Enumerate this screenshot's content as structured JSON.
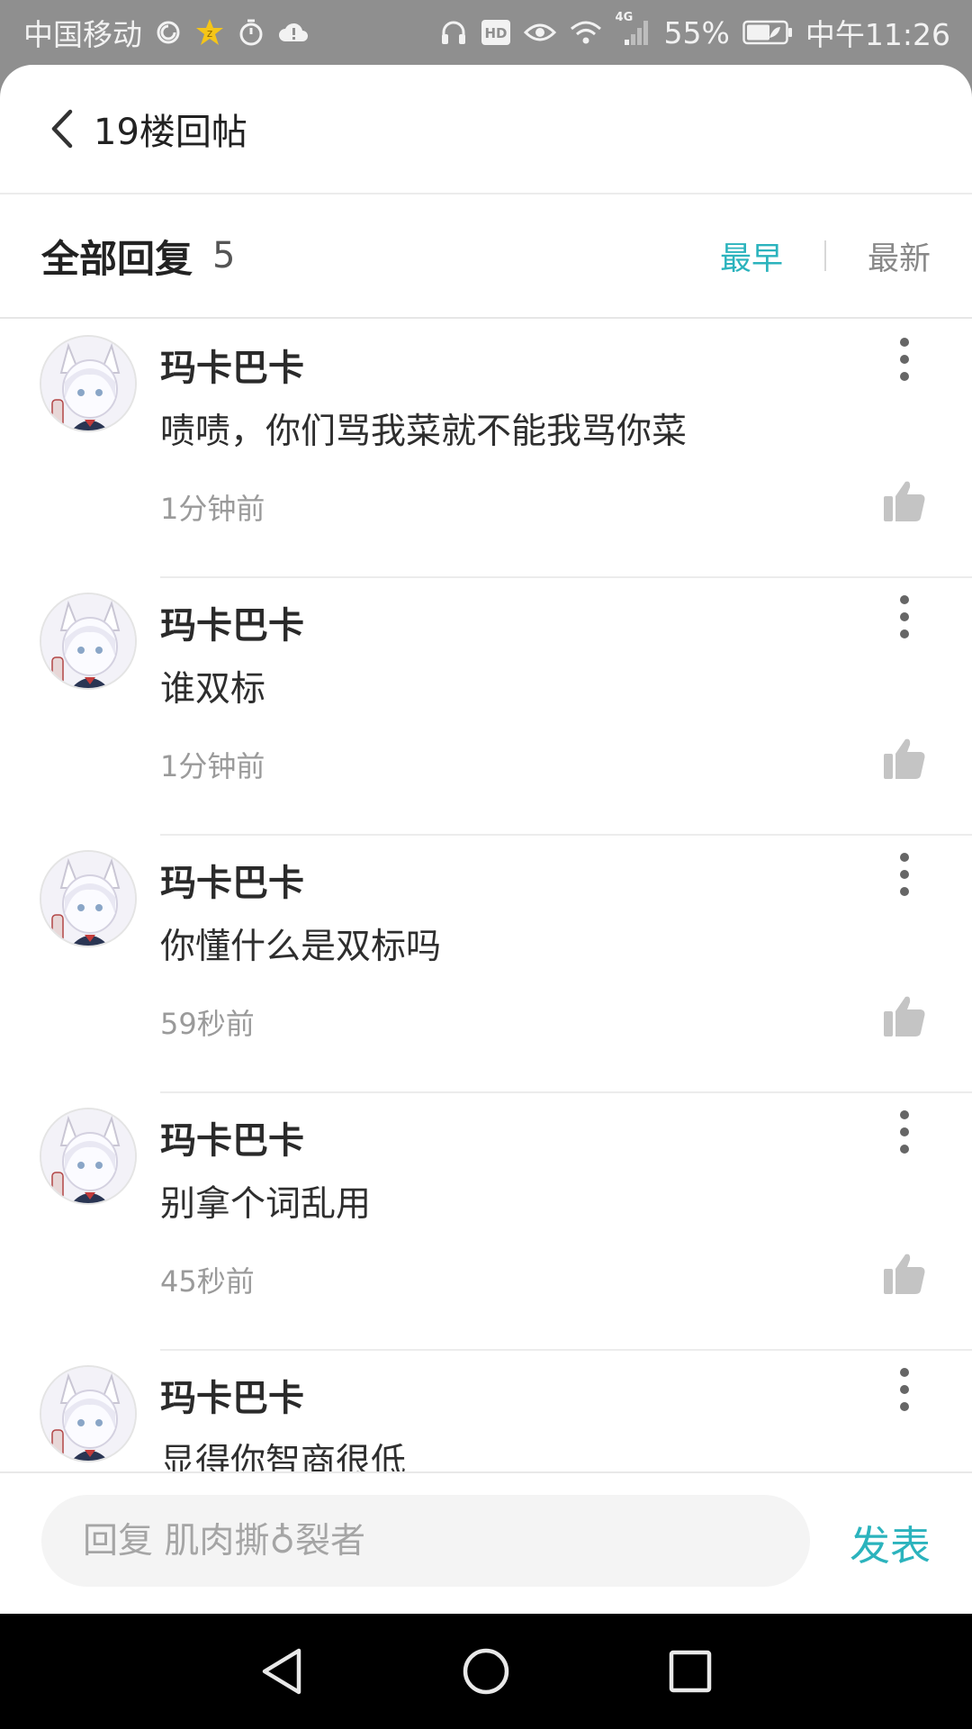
{
  "status_bar": {
    "carrier": "中国移动",
    "network": "4G",
    "battery": "55%",
    "time": "中午11:26",
    "icons": [
      "sync-icon",
      "star-badge-icon",
      "timer-icon",
      "cloud-alert-icon",
      "headphones-icon",
      "hd-icon",
      "eye-icon",
      "wifi-icon",
      "signal-icon",
      "battery-icon"
    ]
  },
  "header": {
    "back_icon": "chevron-left-icon",
    "title": "19楼回帖"
  },
  "replies": {
    "title": "全部回复",
    "count": "5",
    "sort_earliest": "最早",
    "sort_latest": "最新",
    "active_sort": "最早"
  },
  "comments": [
    {
      "author": "玛卡巴卡",
      "text": "啧啧，你们骂我菜就不能我骂你菜",
      "time": "1分钟前"
    },
    {
      "author": "玛卡巴卡",
      "text": "谁双标",
      "time": "1分钟前"
    },
    {
      "author": "玛卡巴卡",
      "text": "你懂什么是双标吗",
      "time": "59秒前"
    },
    {
      "author": "玛卡巴卡",
      "text": "别拿个词乱用",
      "time": "45秒前"
    },
    {
      "author": "玛卡巴卡",
      "text": "显得你智商很低",
      "time": ""
    }
  ],
  "input": {
    "placeholder": "回复 肌肉撕♁裂者",
    "send_label": "发表"
  },
  "colors": {
    "accent": "#2bb3bd",
    "status_bar": "#8f8f8f",
    "nav_bar": "#000000"
  }
}
